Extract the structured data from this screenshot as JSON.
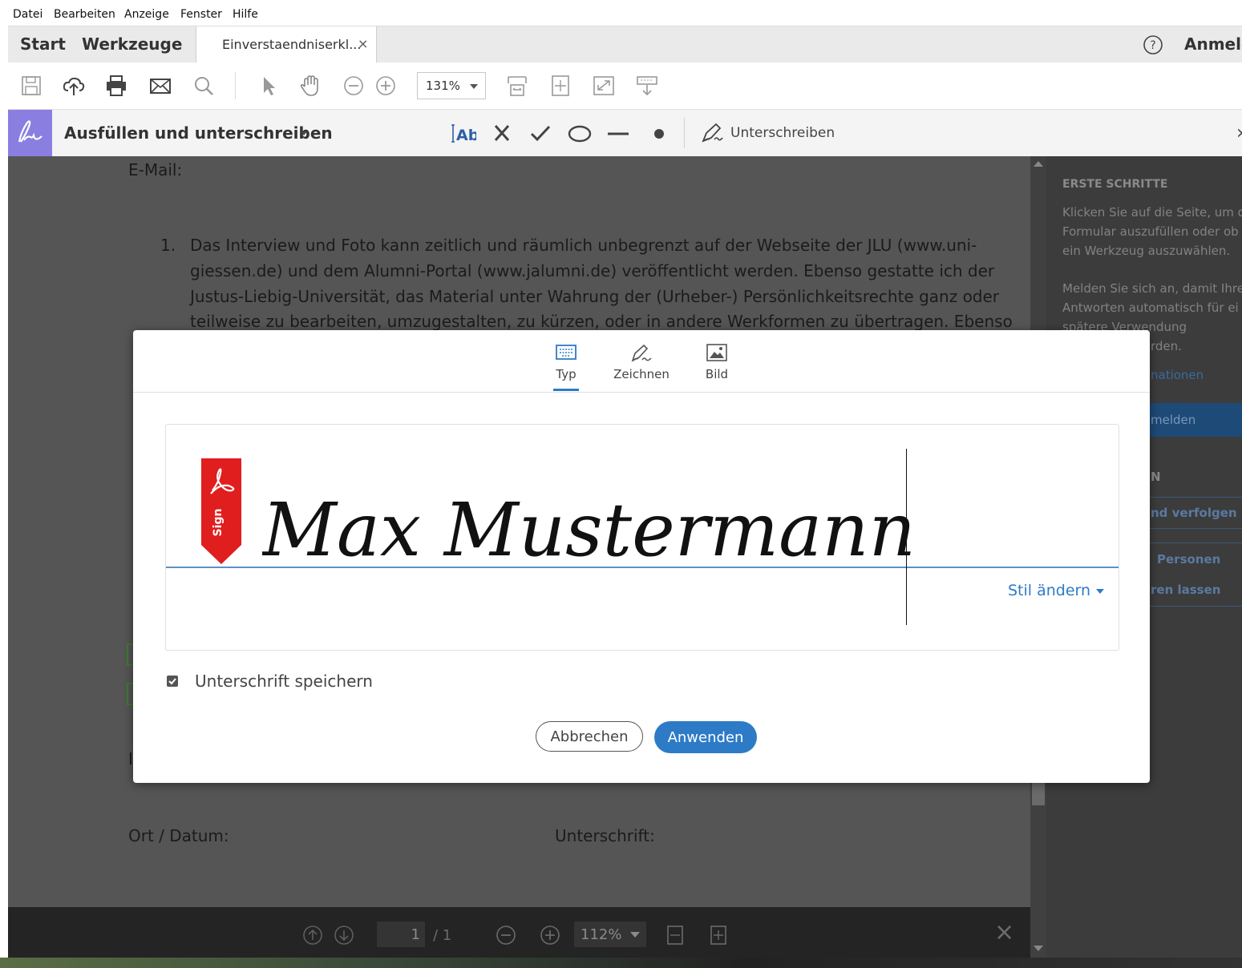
{
  "menu": [
    "Datei",
    "Bearbeiten",
    "Anzeige",
    "Fenster",
    "Hilfe"
  ],
  "tabs": {
    "start": "Start",
    "tools": "Werkzeuge",
    "document": "Einverstaendniserkl...",
    "close": "×",
    "right_label": "Anmelc"
  },
  "toolbar": {
    "zoom": "131%",
    "icons": [
      "save-icon",
      "cloud-upload-icon",
      "print-icon",
      "mail-icon",
      "magnifier-icon",
      "pointer-icon",
      "hand-icon",
      "zoom-out-icon",
      "zoom-in-icon",
      "fit-width-icon",
      "fit-page-icon",
      "fullscreen-icon",
      "read-mode-icon"
    ]
  },
  "fillsign": {
    "title": "Ausfüllen und unterschreiben",
    "text_tool": "Ab",
    "sign_label": "Unterschreiben",
    "close": "›"
  },
  "document": {
    "email_label": "E-Mail:",
    "item_number": "1.",
    "lines": [
      "Das Interview und Foto kann zeitlich und räumlich unbegrenzt auf der Webseite der JLU (www.uni-",
      "giessen.de) und dem Alumni-Portal (www.jalumni.de) veröffentlicht werden. Ebenso gestatte ich der",
      "Justus-Liebig-Universität, das Material unter Wahrung der (Urheber-) Persönlichkeitsrechte ganz oder",
      "teilweise zu bearbeiten, umzugestalten, zu kürzen, oder in andere Werkformen zu übertragen. Ebenso"
    ],
    "ort_datum": "Ort / Datum:",
    "unterschrift": "Unterschrift:",
    "stray_char": "I"
  },
  "right_panel": {
    "heading": "ERSTE SCHRITTE",
    "text1": [
      "Klicken Sie auf die Seite, um d",
      "Formular auszufüllen oder ob",
      "ein Werkzeug auszuwählen."
    ],
    "text2": [
      "Melden Sie sich an, damit Ihre",
      "Antworten automatisch für ei",
      "spätere Verwendung",
      "rden."
    ],
    "link": "nationen",
    "signin_button": "melden",
    "section_letter": "N",
    "action1": "nd verfolgen",
    "action2": "Personen",
    "action3": "ren lassen"
  },
  "bottombar": {
    "page_current": "1",
    "page_total": "/ 1",
    "zoom": "112%",
    "close": "×"
  },
  "modal": {
    "tabs": [
      "Typ",
      "Zeichnen",
      "Bild"
    ],
    "active_tab": "Typ",
    "signature_text": "Max Mustermann",
    "badge_text": "Sign",
    "change_style": "Stil ändern",
    "save_signature_label": "Unterschrift speichern",
    "save_signature_checked": true,
    "cancel": "Abbrechen",
    "apply": "Anwenden"
  },
  "colors": {
    "accent": "#2d7bc7",
    "fillsign_purple": "#8a7fe0",
    "badge_red": "#e01e1e"
  }
}
